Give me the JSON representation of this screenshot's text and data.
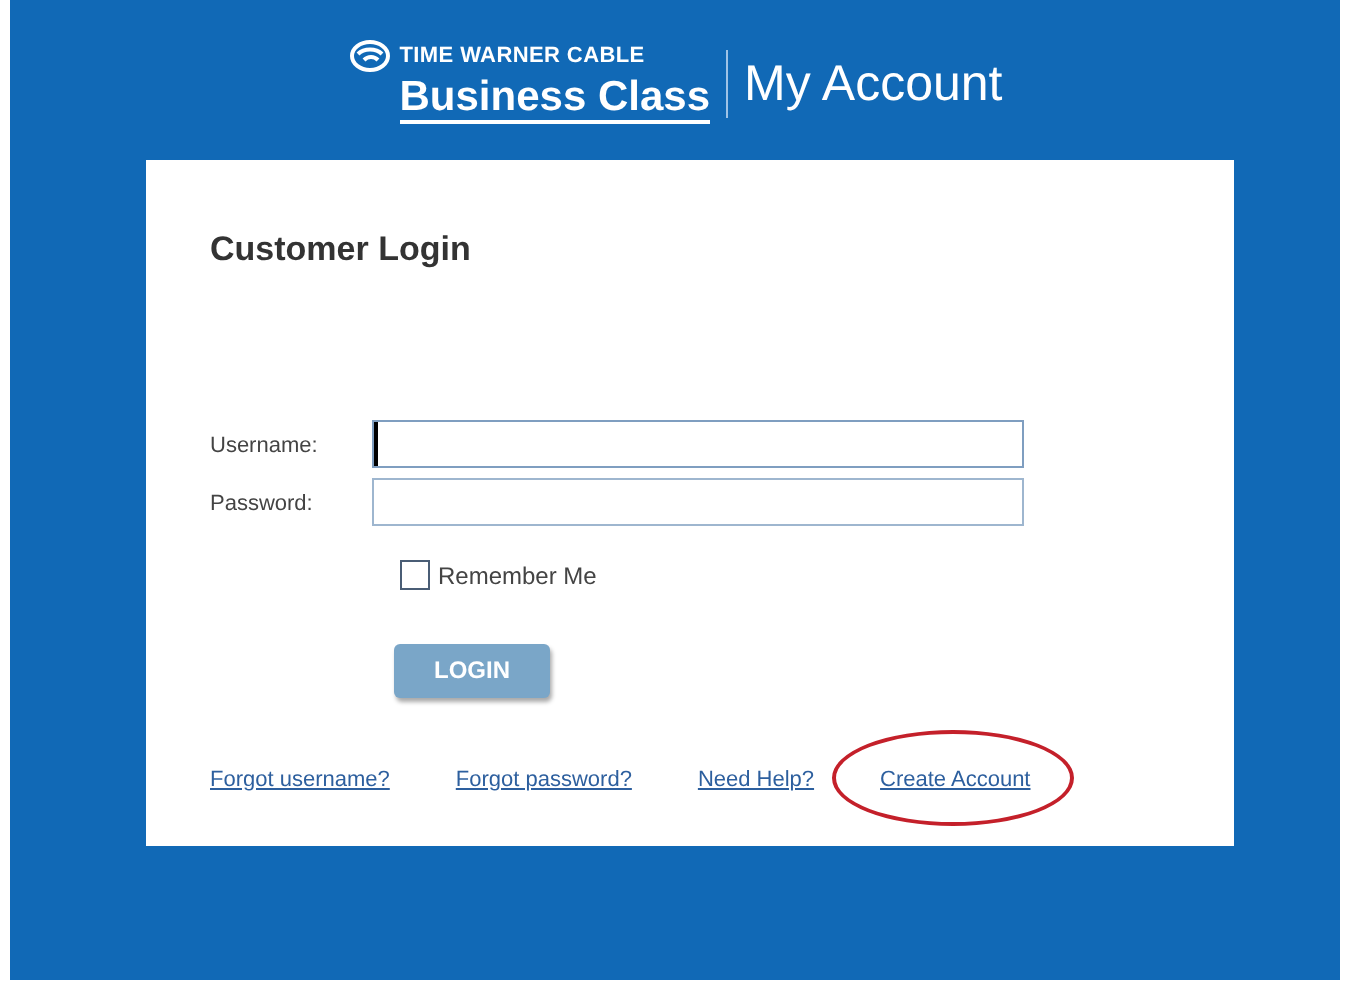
{
  "header": {
    "brand_top": "TIME WARNER CABLE",
    "brand_main": "Business Class",
    "title": "My Account"
  },
  "login": {
    "title": "Customer Login",
    "fields": [
      {
        "label": "Username:",
        "focused": true
      },
      {
        "label": "Password:",
        "focused": false
      }
    ],
    "remember": {
      "label": "Remember Me",
      "checked": false
    },
    "button": "LOGIN",
    "links": [
      {
        "label": "Forgot username?",
        "circled": false
      },
      {
        "label": "Forgot password?",
        "circled": false
      },
      {
        "label": "Need Help?",
        "circled": false
      },
      {
        "label": "Create Account",
        "circled": true
      }
    ]
  }
}
